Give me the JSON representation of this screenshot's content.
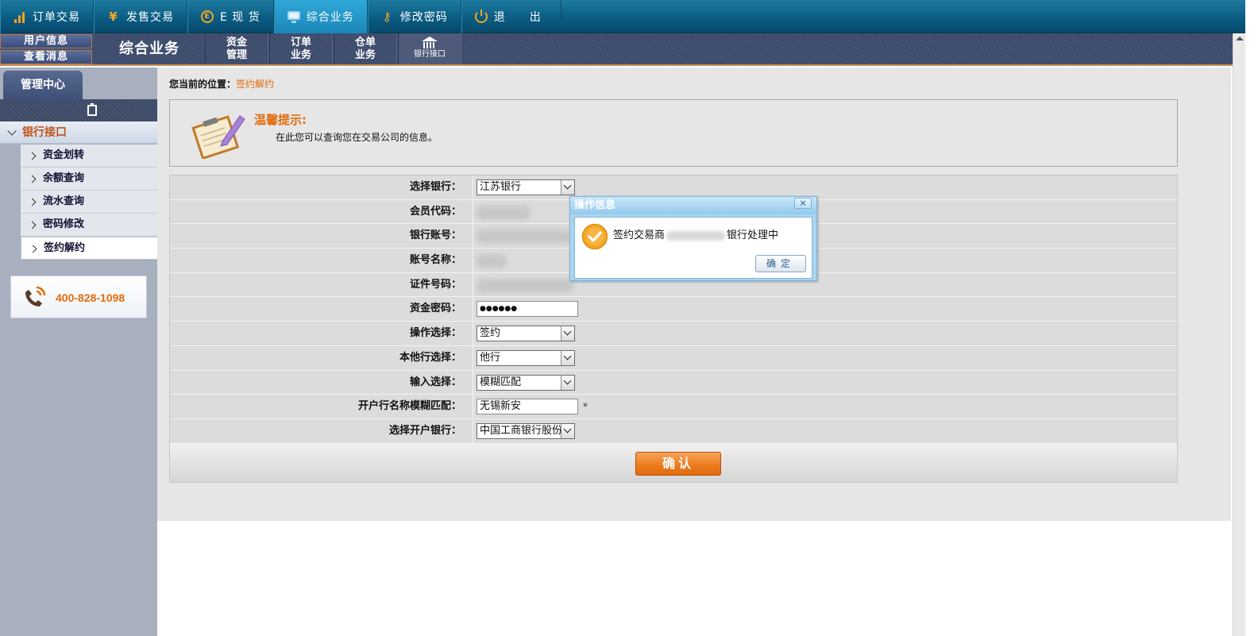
{
  "topnav": {
    "items": [
      {
        "label": "订单交易",
        "icon": "bar-chart-icon"
      },
      {
        "label": "发售交易",
        "icon": "yen-icon"
      },
      {
        "label": "E 现 货",
        "icon": "e-circle-icon"
      },
      {
        "label": "综合业务",
        "icon": "monitor-icon",
        "active": true
      },
      {
        "label": "修改密码",
        "icon": "key-icon"
      },
      {
        "label": "退　　出",
        "icon": "power-icon"
      }
    ]
  },
  "subbar": {
    "user_info": "用户信息",
    "view_messages": "查看消息",
    "section_title": "综合业务",
    "tabs": [
      {
        "line1": "资金",
        "line2": "管理"
      },
      {
        "line1": "订单",
        "line2": "业务"
      },
      {
        "line1": "仓单",
        "line2": "业务"
      },
      {
        "label": "银行接口",
        "active": true
      }
    ]
  },
  "sidebar": {
    "tab": "管理中心",
    "group": "银行接口",
    "items": [
      "资金划转",
      "余额查询",
      "流水查询",
      "密码修改",
      "签约解约"
    ],
    "active_index": 4,
    "phone": "400-828-1098"
  },
  "breadcrumb": {
    "label": "您当前的位置：",
    "current": "签约解约"
  },
  "tip": {
    "title": "温馨提示:",
    "text": "在此您可以查询您在交易公司的信息。"
  },
  "form": {
    "rows": [
      {
        "label": "选择银行：",
        "type": "select",
        "value": "江苏银行"
      },
      {
        "label": "会员代码：",
        "type": "masked"
      },
      {
        "label": "银行账号：",
        "type": "masked"
      },
      {
        "label": "账号名称：",
        "type": "masked"
      },
      {
        "label": "证件号码：",
        "type": "masked"
      },
      {
        "label": "资金密码：",
        "type": "password",
        "value": "●●●●●●"
      },
      {
        "label": "操作选择：",
        "type": "select",
        "value": "签约"
      },
      {
        "label": "本他行选择：",
        "type": "select",
        "value": "他行"
      },
      {
        "label": "输入选择：",
        "type": "select",
        "value": "模糊匹配"
      },
      {
        "label": "开户行名称模糊匹配：",
        "type": "text",
        "value": "无锡新安",
        "required_mark": "*"
      },
      {
        "label": "选择开户银行：",
        "type": "select",
        "value": "中国工商银行股份"
      }
    ],
    "submit_label": "确认"
  },
  "dialog": {
    "title": "操作信息",
    "close_label": "×",
    "message_prefix": "签约交易商",
    "message_suffix": "银行处理中",
    "ok_label": "确定"
  },
  "colors": {
    "accent_orange": "#e26c0c",
    "nav_blue": "#0a5a80",
    "subbar_navy": "#3b4a6b"
  }
}
